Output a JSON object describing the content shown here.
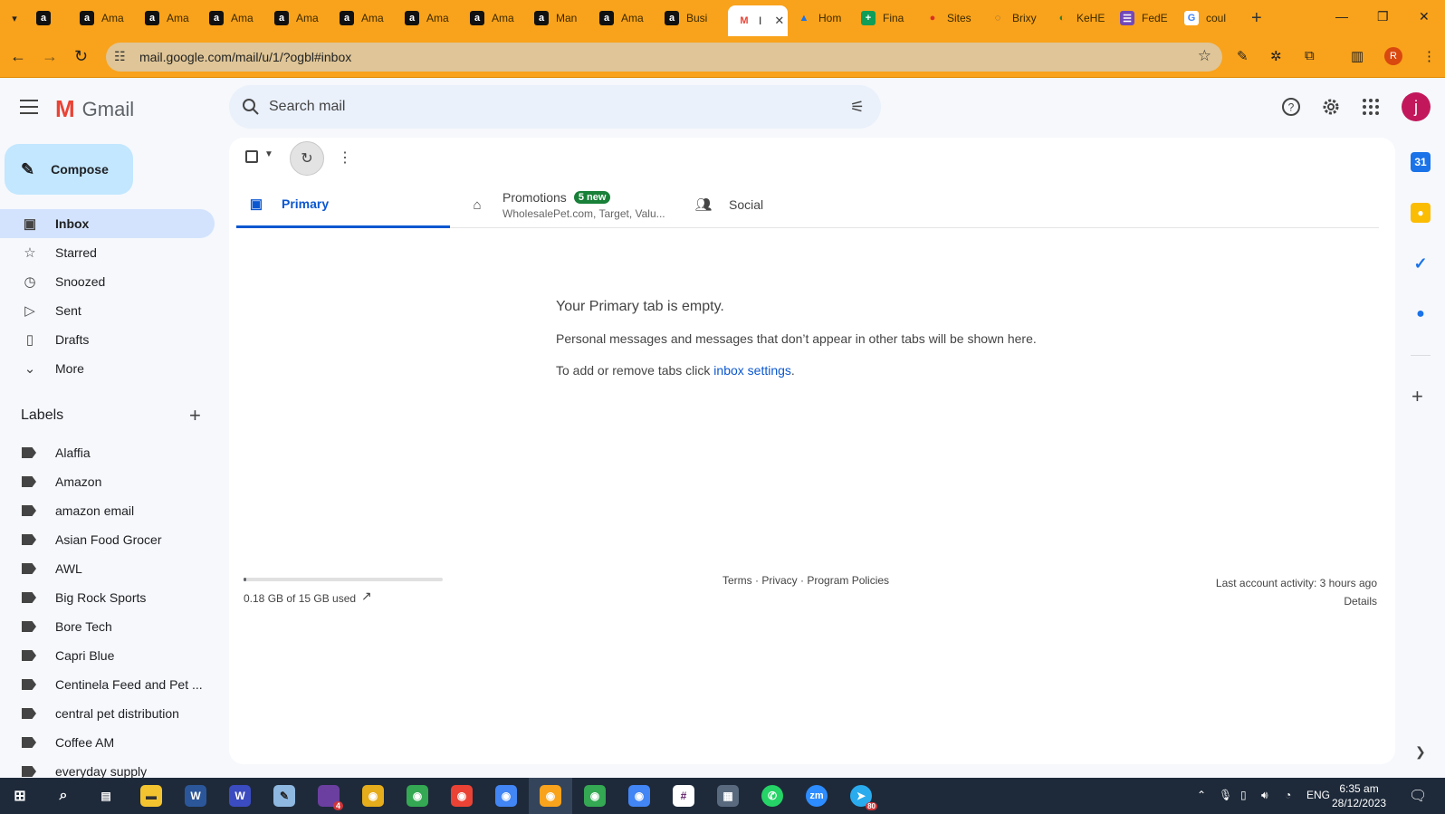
{
  "browser": {
    "tabs": [
      {
        "label": "",
        "icon": "amazon-icon"
      },
      {
        "label": "Ama",
        "icon": "amazon-icon"
      },
      {
        "label": "Ama",
        "icon": "amazon-icon"
      },
      {
        "label": "Ama",
        "icon": "amazon-icon"
      },
      {
        "label": "Ama",
        "icon": "amazon-icon"
      },
      {
        "label": "Ama",
        "icon": "amazon-icon"
      },
      {
        "label": "Ama",
        "icon": "amazon-icon"
      },
      {
        "label": "Ama",
        "icon": "amazon-icon"
      },
      {
        "label": "Man",
        "icon": "amazon-icon"
      },
      {
        "label": "Ama",
        "icon": "amazon-icon"
      },
      {
        "label": "Busi",
        "icon": "amazon-icon"
      },
      {
        "label": "I",
        "icon": "gmail-icon",
        "active": true
      },
      {
        "label": "Hom",
        "icon": "drive-icon"
      },
      {
        "label": "Fina",
        "icon": "sheets-icon"
      },
      {
        "label": "Sites",
        "icon": "sites-icon"
      },
      {
        "label": "Brixy",
        "icon": "brixy-icon"
      },
      {
        "label": "KeHE",
        "icon": "kehe-icon"
      },
      {
        "label": "FedE",
        "icon": "forms-icon"
      },
      {
        "label": "coul",
        "icon": "google-icon"
      }
    ],
    "url": "mail.google.com/mail/u/1/?ogbl#inbox",
    "profile_initial": "R"
  },
  "gmail": {
    "product_name": "Gmail",
    "search_placeholder": "Search mail",
    "avatar_initial": "j",
    "compose_label": "Compose",
    "nav": [
      {
        "label": "Inbox",
        "icon": "inbox-icon",
        "active": true
      },
      {
        "label": "Starred",
        "icon": "star-icon"
      },
      {
        "label": "Snoozed",
        "icon": "clock-icon"
      },
      {
        "label": "Sent",
        "icon": "send-icon"
      },
      {
        "label": "Drafts",
        "icon": "draft-icon"
      },
      {
        "label": "More",
        "icon": "chevron-down-icon"
      }
    ],
    "labels_heading": "Labels",
    "labels": [
      "Alaffia",
      "Amazon",
      "amazon email",
      "Asian Food Grocer",
      "AWL",
      "Big Rock Sports",
      "Bore Tech",
      "Capri Blue",
      "Centinela Feed and Pet ...",
      "central pet distribution",
      "Coffee AM",
      "everyday supply"
    ],
    "tabs": {
      "primary": "Primary",
      "promotions": "Promotions",
      "promotions_badge": "5 new",
      "promotions_senders": "WholesalePet.com, Target, Valu...",
      "social": "Social"
    },
    "empty": {
      "title": "Your Primary tab is empty.",
      "body": "Personal messages and messages that don’t appear in other tabs will be shown here.",
      "hint_prefix": "To add or remove tabs click ",
      "hint_link": "inbox settings",
      "hint_suffix": "."
    },
    "storage": {
      "used_text": "0.18 GB of 15 GB used",
      "used_fraction": 0.012
    },
    "footer": {
      "terms": "Terms",
      "privacy": "Privacy",
      "policies": "Program Policies",
      "activity": "Last account activity: 3 hours ago",
      "details": "Details"
    }
  },
  "taskbar": {
    "notification_badges": [
      "4",
      "80"
    ],
    "language": "ENG",
    "time": "6:35 am",
    "date": "28/12/2023"
  },
  "colors": {
    "browser_frame": "#f9a21b",
    "compose_bg": "#c2e7ff",
    "active_nav": "#d3e3fd",
    "link_blue": "#0b57d0",
    "badge_green": "#188038"
  }
}
